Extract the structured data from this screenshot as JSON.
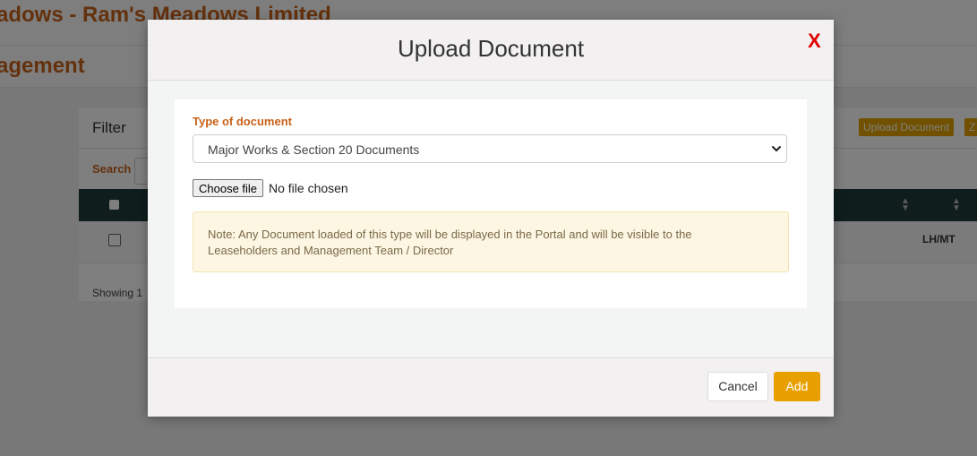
{
  "background": {
    "title": "adows - Ram's Meadows Limited",
    "subtitle": "agement",
    "filter_label": "Filter",
    "upload_button": "Upload Document",
    "z_button": "Z",
    "search_label": "Search",
    "row_cell": "LH/MT",
    "showing_text": "Showing 1"
  },
  "modal": {
    "title": "Upload Document",
    "close_label": "X",
    "type_label": "Type of document",
    "selected_type": "Major Works & Section 20 Documents",
    "file_button": "Choose file",
    "file_status": "No file chosen",
    "note": "Note: Any Document loaded of this type will be displayed in the Portal and will be visible to the Leaseholders and Management Team / Director",
    "cancel_label": "Cancel",
    "add_label": "Add"
  },
  "colors": {
    "accent": "#c8621a",
    "add_button": "#e8a000",
    "close": "#e00000",
    "table_header": "#1e3a3a",
    "note_bg": "#fdf6e3"
  },
  "icons": {
    "select_arrow": "chevron-down-icon",
    "sort": "sort-icon"
  }
}
